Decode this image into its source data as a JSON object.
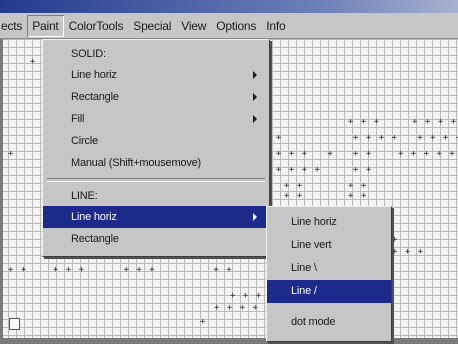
{
  "menubar": {
    "items": [
      "ects",
      "Paint",
      "ColorTools",
      "Special",
      "View",
      "Options",
      "Info"
    ]
  },
  "paint_menu": {
    "solid_header": "SOLID:",
    "solid_items": [
      {
        "label": "Line horiz",
        "submenu": true
      },
      {
        "label": "Rectangle",
        "submenu": true
      },
      {
        "label": "Fill",
        "submenu": true
      },
      {
        "label": "Circle",
        "submenu": false
      },
      {
        "label": "Manual (Shift+mousemove)",
        "submenu": false
      }
    ],
    "line_header": "LINE:",
    "line_items": [
      {
        "label": "Line horiz",
        "submenu": true,
        "highlighted": true
      },
      {
        "label": "Rectangle",
        "submenu": false
      }
    ]
  },
  "line_submenu": {
    "items": [
      {
        "label": "Line horiz",
        "highlighted": false
      },
      {
        "label": "Line vert",
        "highlighted": false
      },
      {
        "label": "Line \\",
        "highlighted": false
      },
      {
        "label": "Line /",
        "highlighted": true
      }
    ],
    "last_item": "dot mode"
  },
  "colors": {
    "menu_bg": "#c6c6c6",
    "highlight": "#1c2a8c",
    "title_bar": "#243a8e",
    "canvas": "#f3f3f3",
    "grid": "#b9b9b9"
  }
}
